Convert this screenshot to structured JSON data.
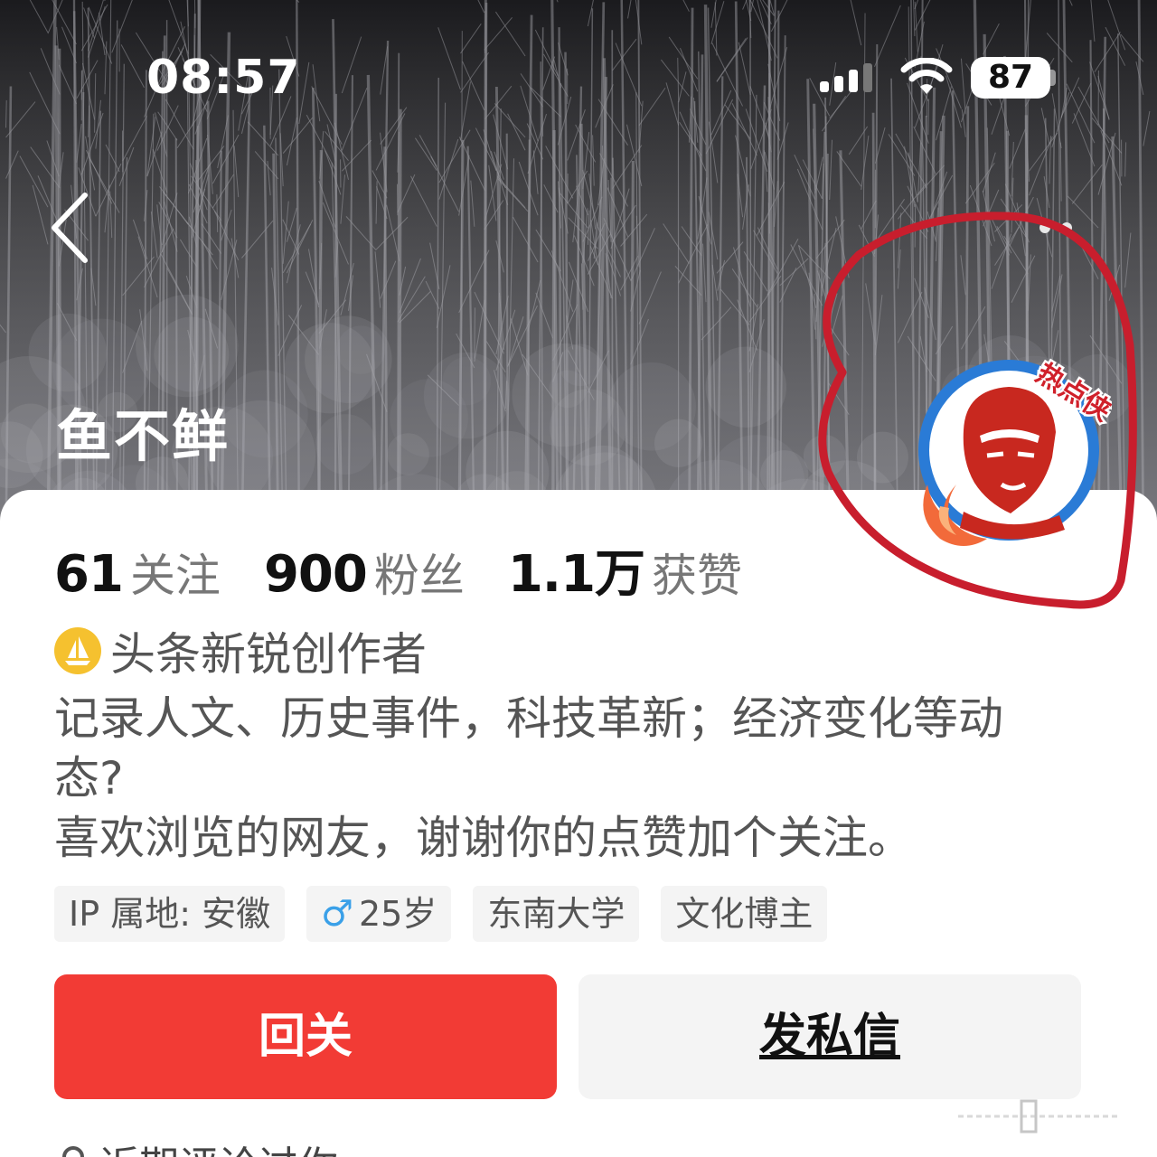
{
  "status_bar": {
    "time": "08:57",
    "battery": "87"
  },
  "profile": {
    "name": "鱼不鲜",
    "avatar_badge": "热点侠",
    "stats": [
      {
        "value": "61",
        "label": "关注"
      },
      {
        "value": "900",
        "label": "粉丝"
      },
      {
        "value": "1.1万",
        "label": "获赞"
      }
    ],
    "creator_badge": "头条新锐创作者",
    "bio": [
      "记录人文、历史事件，科技革新；经济变化等动",
      "态?",
      "喜欢浏览的网友，谢谢你的点赞加个关注。"
    ],
    "tags": [
      "IP 属地: 安徽",
      "25岁",
      "东南大学",
      "文化博主"
    ]
  },
  "actions": {
    "follow_label": "回关",
    "message_label": "发私信"
  },
  "recent": {
    "label": "近期评论过你"
  },
  "colors": {
    "follow_red": "#f23b35",
    "annotation_red": "#c81e2d",
    "badge_yellow": "#f5c12f",
    "avatar_blue": "#2a7bd6"
  }
}
